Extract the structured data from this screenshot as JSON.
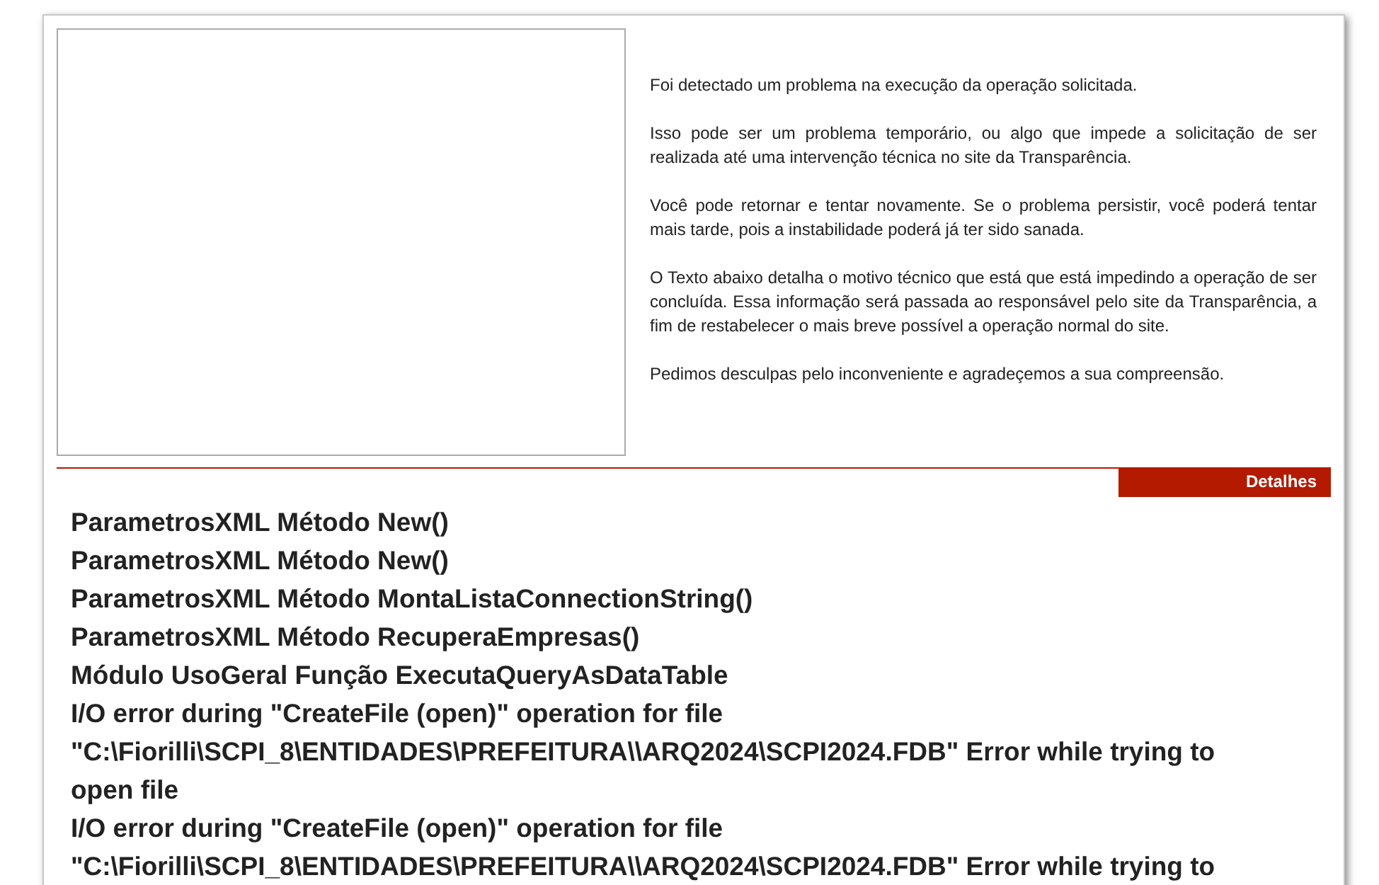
{
  "message": {
    "paragraphs": [
      "Foi detectado um problema na execução da operação solicitada.",
      "Isso pode ser um problema temporário, ou algo que impede a solicitação de ser realizada até uma intervenção técnica no site da Transparência.",
      "Você pode retornar e tentar novamente. Se o problema persistir, você poderá tentar mais tarde, pois a instabilidade poderá já ter sido sanada.",
      "O Texto abaixo detalha o motivo técnico que está que está impedindo a operação de ser concluída. Essa informação será passada ao responsável pelo site da Transparência, a fim de restabelecer o mais breve possível a operação normal do site.",
      "Pedimos desculpas pelo inconveniente e agradeçemos a sua compreensão."
    ]
  },
  "details": {
    "label": "Detalhes",
    "lines": [
      "ParametrosXML Método New()",
      "ParametrosXML Método New()",
      "ParametrosXML Método MontaListaConnectionString()",
      "ParametrosXML Método RecuperaEmpresas()",
      "Módulo UsoGeral Função ExecutaQueryAsDataTable",
      "I/O error during \"CreateFile (open)\" operation for file",
      "\"C:\\Fiorilli\\SCPI_8\\ENTIDADES\\PREFEITURA\\\\ARQ2024\\SCPI2024.FDB\" Error while trying to",
      "open file",
      "I/O error during \"CreateFile (open)\" operation for file",
      "\"C:\\Fiorilli\\SCPI_8\\ENTIDADES\\PREFEITURA\\\\ARQ2024\\SCPI2024.FDB\" Error while trying to"
    ]
  }
}
